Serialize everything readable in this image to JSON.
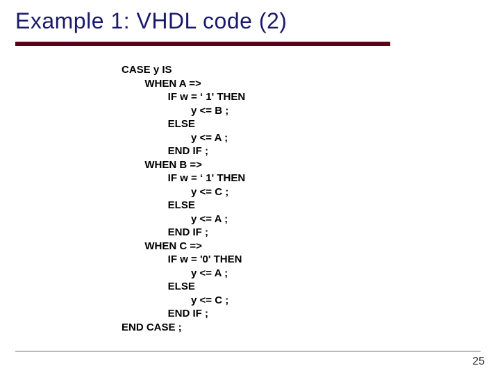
{
  "title": "Example 1: VHDL code (2)",
  "page_number": "25",
  "code": "CASE y IS\n        WHEN A =>\n                IF w = ‘ 1' THEN\n                        y <= B ;\n                ELSE\n                        y <= A ;\n                END IF ;\n        WHEN B =>\n                IF w = ‘ 1' THEN\n                        y <= C ;\n                ELSE\n                        y <= A ;\n                END IF ;\n        WHEN C =>\n                IF w = '0' THEN\n                        y <= A ;\n                ELSE\n                        y <= C ;\n                END IF ;\nEND CASE ;"
}
